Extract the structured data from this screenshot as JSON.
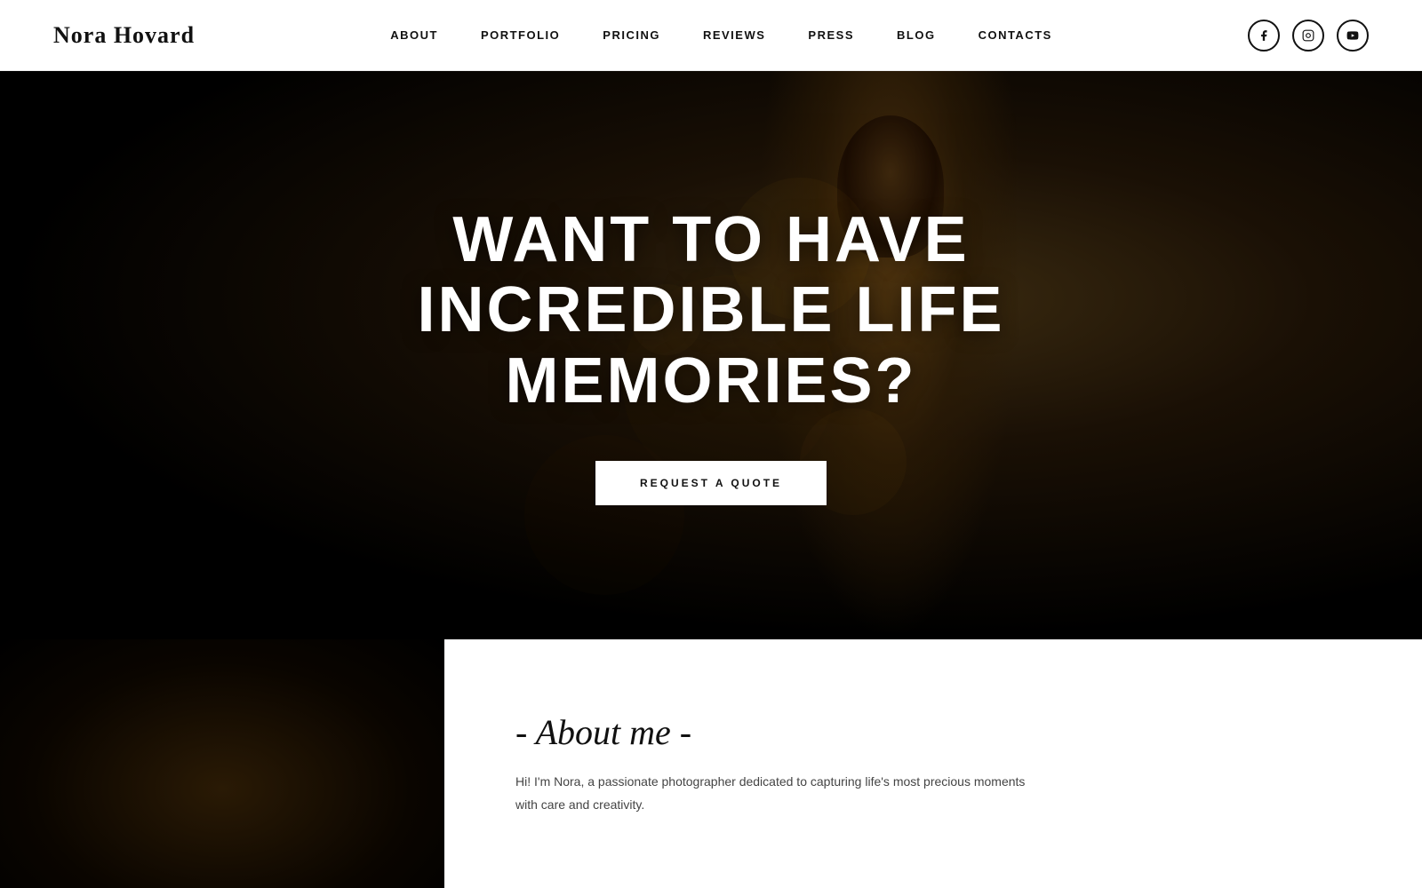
{
  "brand": {
    "name": "Nora Hovard"
  },
  "nav": {
    "links": [
      {
        "id": "about",
        "label": "ABOUT"
      },
      {
        "id": "portfolio",
        "label": "PORTFOLIO"
      },
      {
        "id": "pricing",
        "label": "PRICING"
      },
      {
        "id": "reviews",
        "label": "REVIEWS"
      },
      {
        "id": "press",
        "label": "PRESS"
      },
      {
        "id": "blog",
        "label": "BLOG"
      },
      {
        "id": "contacts",
        "label": "CONTACTS"
      }
    ],
    "social": [
      {
        "id": "facebook",
        "icon": "f",
        "label": "Facebook"
      },
      {
        "id": "instagram",
        "icon": "ig",
        "label": "Instagram"
      },
      {
        "id": "youtube",
        "icon": "yt",
        "label": "YouTube"
      }
    ]
  },
  "hero": {
    "title_line1": "WANT TO HAVE INCREDIBLE LIFE",
    "title_line2": "MEMORIES?",
    "cta_button": "REQUEST A QUOTE"
  },
  "about": {
    "section_title": "- About me -",
    "description": "Hi! I'm Nora, a passionate photographer dedicated to capturing life's most precious moments with care and creativity."
  }
}
